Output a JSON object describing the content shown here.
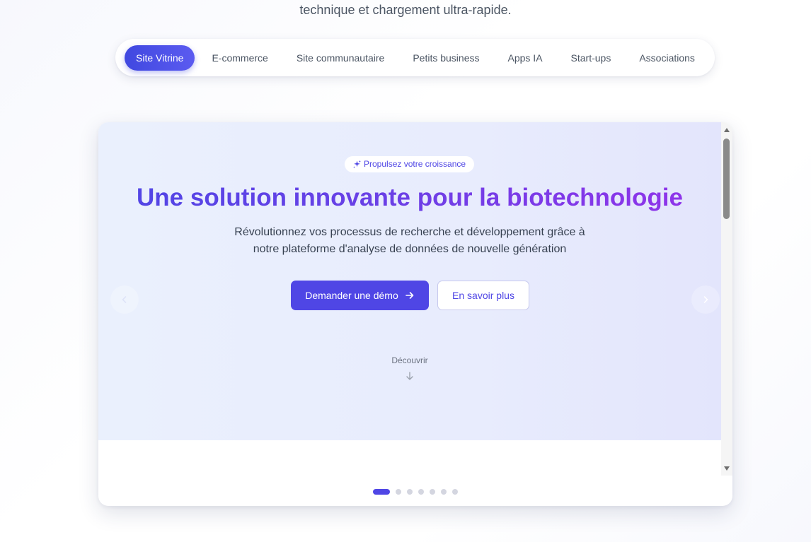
{
  "intro": {
    "text": "technique et chargement ultra-rapide."
  },
  "tabs": [
    {
      "label": "Site Vitrine",
      "active": true
    },
    {
      "label": "E-commerce",
      "active": false
    },
    {
      "label": "Site communautaire",
      "active": false
    },
    {
      "label": "Petits business",
      "active": false
    },
    {
      "label": "Apps IA",
      "active": false
    },
    {
      "label": "Start-ups",
      "active": false
    },
    {
      "label": "Associations",
      "active": false
    }
  ],
  "hero": {
    "badge": "Propulsez votre croissance",
    "badge_icon": "sparkles-icon",
    "title": "Une solution innovante pour la biotechnologie",
    "subtitle_line1": "Révolutionnez vos processus de recherche et développement grâce à",
    "subtitle_line2": "notre plateforme d'analyse de données de nouvelle génération",
    "primary_button": "Demander une démo",
    "secondary_button": "En savoir plus",
    "discover_label": "Découvrir"
  },
  "carousel": {
    "slide_count": 7,
    "active_index": 0,
    "prev_icon": "chevron-left-icon",
    "next_icon": "chevron-right-icon"
  },
  "colors": {
    "accent": "#4f46e5",
    "accent_purple": "#9333ea",
    "hero_bg": "#e8ecfd",
    "text_muted": "#4b5563"
  }
}
